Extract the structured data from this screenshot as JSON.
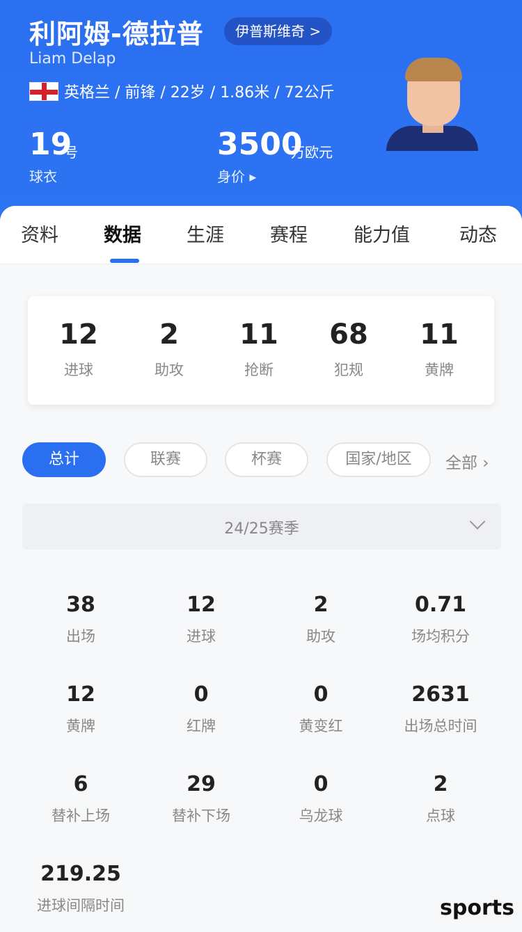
{
  "header": {
    "name": "利阿姆-德拉普",
    "club": "伊普斯维奇 >",
    "en_name": "Liam Delap",
    "country": "英格兰",
    "bio": "英格兰 / 前锋 / 22岁 / 1.86米 / 72公斤",
    "flag_icon": "england-flag-icon",
    "jersey_number": "19",
    "jersey_unit": "号",
    "jersey_label": "球衣",
    "market_value": "3500",
    "market_value_unit": "万欧元",
    "market_value_label": "身价 ▸",
    "accent_color": "#2a6ff0"
  },
  "tabs": [
    {
      "label": "资料"
    },
    {
      "label": "数据",
      "active": true
    },
    {
      "label": "生涯"
    },
    {
      "label": "赛程"
    },
    {
      "label": "能力值"
    },
    {
      "label": "动态"
    }
  ],
  "summary": [
    {
      "value": "12",
      "label": "进球"
    },
    {
      "value": "2",
      "label": "助攻"
    },
    {
      "value": "11",
      "label": "抢断"
    },
    {
      "value": "68",
      "label": "犯规"
    },
    {
      "value": "11",
      "label": "黄牌"
    }
  ],
  "filters": [
    {
      "label": "总计",
      "active": true
    },
    {
      "label": "联赛"
    },
    {
      "label": "杯赛"
    },
    {
      "label": "国家/地区"
    }
  ],
  "filter_more": "全部 ›",
  "season": "24/25赛季",
  "stats": [
    {
      "value": "38",
      "label": "出场"
    },
    {
      "value": "12",
      "label": "进球"
    },
    {
      "value": "2",
      "label": "助攻"
    },
    {
      "value": "0.71",
      "label": "场均积分"
    },
    {
      "value": "12",
      "label": "黄牌"
    },
    {
      "value": "0",
      "label": "红牌"
    },
    {
      "value": "0",
      "label": "黄变红"
    },
    {
      "value": "2631",
      "label": "出场总时间"
    },
    {
      "value": "6",
      "label": "替补上场"
    },
    {
      "value": "29",
      "label": "替补下场"
    },
    {
      "value": "0",
      "label": "乌龙球"
    },
    {
      "value": "2",
      "label": "点球"
    },
    {
      "value": "219.25",
      "label": "进球间隔时间"
    }
  ],
  "watermark": "sports"
}
